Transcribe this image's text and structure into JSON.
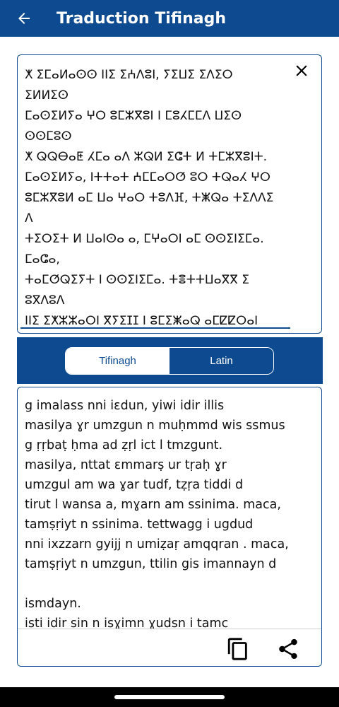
{
  "app": {
    "title": "Traduction Tifinagh"
  },
  "icons": {
    "back": "arrow-left-icon",
    "clear": "close-icon",
    "copy": "copy-icon",
    "share": "share-icon"
  },
  "colors": {
    "primary": "#0d4a8f",
    "surface": "#ffffff",
    "text": "#111111"
  },
  "tifinagh": {
    "text": "ⵅ ⵉⵎⴰⵍⴰⵙⵙ ⵏⵏⵉ ⵉⵄⴷⵓⵏ, ⵢⵉⵡⵉ ⵉⴷⵉⵔ\nⵉⵍⵍⵉⵙ\nⵎⴰⵙⵉⵍⵢⴰ ⵖⵔ ⵓⵎⵣⴳⵓⵏ ⵏ ⵎⵓⵃⵎⵎⴷ ⵡⵉⵙ\nⵙⵙⵎⵓⵙ\nⵅ ⵕⵕⴱⴰⵟ ⵃⵎⴰ ⴰⴷ ⵣⵕⵍ ⵉⵛⵜ ⵍ ⵜⵎⵣⴳⵓⵏⵜ.\nⵎⴰⵙⵉⵍⵢⴰ, ⵏⵜⵜⴰⵜ ⵄⵎⵎⴰⵔⵚ ⵓⵔ ⵜⵕⴰⵃ ⵖⵔ\nⵓⵎⵣⴳⵓⵍ ⴰⵎ ⵡⴰ ⵖⴰⵔ ⵜⵓⴷⴼ, ⵜⵥⵕⴰ ⵜⵉⴷⴷⵉ\nⴷ\nⵜⵉⵔⵉⵜ ⵍ ⵡⴰⵏⵙⴰ ⴰ, ⵎⵖⴰⵔⵏ ⴰⵎ ⵙⵙⵉⵏⵉⵎⴰ.\nⵎⴰⵛⴰ,\nⵜⴰⵎⵚⵕⵉⵢⵜ ⵏ ⵙⵙⵉⵏⵉⵎⴰ. ⵜⴻⵜⵜⵡⴰⴳⴳ ⵉ\nⵓⴳⴷⵓⴷ\nⵏⵏⵉ ⵉⵅⵣⵣⴰⵔⵏ ⴳⵢⵉⵊⵊ ⵏ ⵓⵎⵉⵥⴰⵕ ⴰⵎⵇⵇⵔⴰⵏ"
  },
  "toggle": {
    "tifinagh_label": "Tifinagh",
    "latin_label": "Latin",
    "selected": "Tifinagh"
  },
  "latin": {
    "text": "g imalass nni iɛdun, yiwi idir illis\nmasilya ɣr umzgun n muḥmmd wis ssmus\ng ṛṛbaṭ ḥma ad ẓṛl ict l tmzgunt.\nmasilya, nttat ɛmmarṣ ur tṛaḥ ɣr\numzgul am wa ɣar tudf, tẓṛa tiddi d\ntirut l wansa a, mɣarn am ssinima. maca,\ntamṣṛiyt n ssinima. tettwagg i ugdud\nnni ixzzarn gyijj n umiẓaṛ amqqran . maca,\ntamṣṛiyt n umzgun, ttilin gis imannayn d\n\nismdayn.\nisti idir sin n isɣimn ɣudsn i tamc"
  }
}
